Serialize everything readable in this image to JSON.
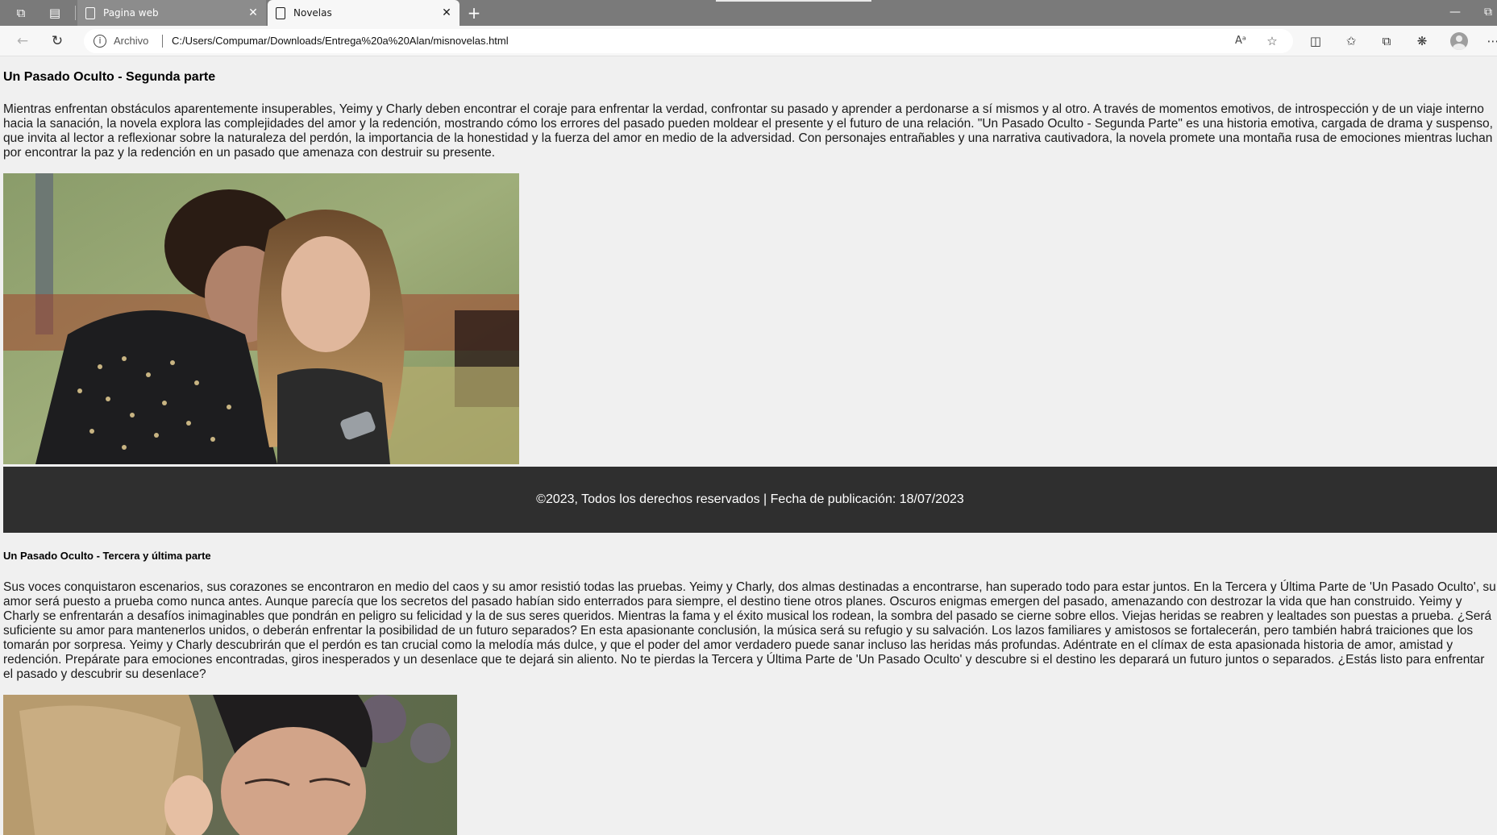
{
  "browser": {
    "tabs": [
      {
        "title": "Pagina web",
        "active": false
      },
      {
        "title": "Novelas",
        "active": true
      }
    ],
    "address": {
      "scheme_label": "Archivo",
      "url": "C:/Users/Compumar/Downloads/Entrega%20a%20Alan/misnovelas.html"
    },
    "icons": {
      "workspaces": "workspaces-icon",
      "tab_actions": "tab-actions-icon",
      "back": "back-arrow-icon",
      "refresh": "refresh-icon",
      "info": "info-icon",
      "read_aloud": "read-aloud-icon",
      "favorite": "star-icon",
      "split": "split-screen-icon",
      "favorites": "favorites-icon",
      "collections": "collections-icon",
      "extensions": "extensions-icon",
      "profile": "profile-avatar",
      "more": "more-icon"
    }
  },
  "page": {
    "novel1": {
      "title": "Un Pasado Oculto - Segunda parte",
      "text": "Mientras enfrentan obstáculos aparentemente insuperables, Yeimy y Charly deben encontrar el coraje para enfrentar la verdad, confrontar su pasado y aprender a perdonarse a sí mismos y al otro. A través de momentos emotivos, de introspección y de un viaje interno hacia la sanación, la novela explora las complejidades del amor y la redención, mostrando cómo los errores del pasado pueden moldear el presente y el futuro de una relación. \"Un Pasado Oculto - Segunda Parte\" es una historia emotiva, cargada de drama y suspenso, que invita al lector a reflexionar sobre la naturaleza del perdón, la importancia de la honestidad y la fuerza del amor en medio de la adversidad. Con personajes entrañables y una narrativa cautivadora, la novela promete una montaña rusa de emociones mientras luchan por encontrar la paz y la redención en un pasado que amenaza con destruir su presente."
    },
    "footer": {
      "text": "©2023, Todos los derechos reservados | Fecha de publicación: 18/07/2023"
    },
    "novel2": {
      "title": "Un Pasado Oculto - Tercera y última parte",
      "text": "Sus voces conquistaron escenarios, sus corazones se encontraron en medio del caos y su amor resistió todas las pruebas. Yeimy y Charly, dos almas destinadas a encontrarse, han superado todo para estar juntos. En la Tercera y Última Parte de 'Un Pasado Oculto', su amor será puesto a prueba como nunca antes. Aunque parecía que los secretos del pasado habían sido enterrados para siempre, el destino tiene otros planes. Oscuros enigmas emergen del pasado, amenazando con destrozar la vida que han construido. Yeimy y Charly se enfrentarán a desafíos inimaginables que pondrán en peligro su felicidad y la de sus seres queridos. Mientras la fama y el éxito musical los rodean, la sombra del pasado se cierne sobre ellos. Viejas heridas se reabren y lealtades son puestas a prueba. ¿Será suficiente su amor para mantenerlos unidos, o deberán enfrentar la posibilidad de un futuro separados? En esta apasionante conclusión, la música será su refugio y su salvación. Los lazos familiares y amistosos se fortalecerán, pero también habrá traiciones que los tomarán por sorpresa. Yeimy y Charly descubrirán que el perdón es tan crucial como la melodía más dulce, y que el poder del amor verdadero puede sanar incluso las heridas más profundas. Adéntrate en el clímax de esta apasionada historia de amor, amistad y redención. Prepárate para emociones encontradas, giros inesperados y un desenlace que te dejará sin aliento. No te pierdas la Tercera y Última Parte de 'Un Pasado Oculto' y descubre si el destino les deparará un futuro juntos o separados. ¿Estás listo para enfrentar el pasado y descubrir su desenlace?"
    }
  }
}
